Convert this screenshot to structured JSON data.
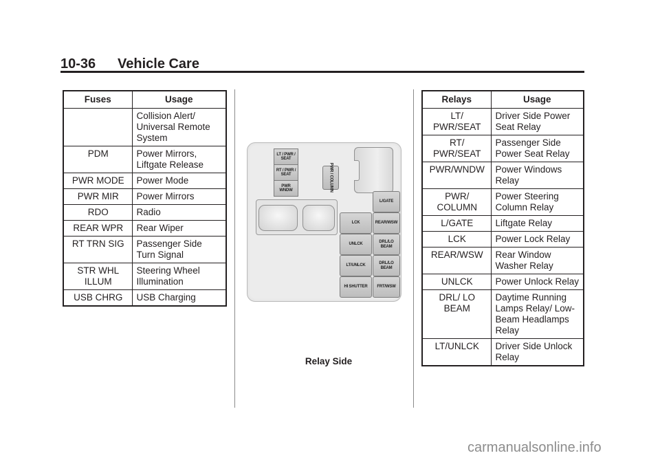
{
  "header": {
    "page_number": "10-36",
    "section_title": "Vehicle Care"
  },
  "fuses_table": {
    "headers": [
      "Fuses",
      "Usage"
    ],
    "rows": [
      {
        "code": "",
        "usage": "Collision Alert/ Universal Remote System"
      },
      {
        "code": "PDM",
        "usage": "Power Mirrors, Liftgate Release"
      },
      {
        "code": "PWR MODE",
        "usage": "Power Mode"
      },
      {
        "code": "PWR MIR",
        "usage": "Power Mirrors"
      },
      {
        "code": "RDO",
        "usage": "Radio"
      },
      {
        "code": "REAR WPR",
        "usage": "Rear Wiper"
      },
      {
        "code": "RT TRN SIG",
        "usage": "Passenger Side Turn Signal"
      },
      {
        "code": "STR WHL ILLUM",
        "usage": "Steering Wheel Illumination"
      },
      {
        "code": "USB CHRG",
        "usage": "USB Charging"
      }
    ]
  },
  "diagram": {
    "caption": "Relay Side",
    "relays": {
      "lt_pwr_seat": "LT / PWR / SEAT",
      "rt_pwr_seat": "RT / PWR / SEAT",
      "pwr_wndw": "PWR WNDW",
      "pwr_column": "PWR / COLUMN",
      "l_gate": "L/GATE",
      "lck": "LCK",
      "rear_wsw": "REAR/WSW",
      "unlck": "UNLCK",
      "drl_lo_beam_1": "DRL/LO BEAM",
      "lt_unlck": "LT/UNLCK",
      "drl_lo_beam_2": "DRL/LO BEAM",
      "hi_shutter": "HI SHUTTER",
      "frt_wsw": "FRT/WSW"
    }
  },
  "relays_table": {
    "headers": [
      "Relays",
      "Usage"
    ],
    "rows": [
      {
        "code": "LT/ PWR/SEAT",
        "usage": "Driver Side Power Seat Relay"
      },
      {
        "code": "RT/ PWR/SEAT",
        "usage": "Passenger Side Power Seat Relay"
      },
      {
        "code": "PWR/WNDW",
        "usage": "Power Windows Relay"
      },
      {
        "code": "PWR/ COLUMN",
        "usage": "Power Steering Column Relay"
      },
      {
        "code": "L/GATE",
        "usage": "Liftgate Relay"
      },
      {
        "code": "LCK",
        "usage": "Power Lock Relay"
      },
      {
        "code": "REAR/WSW",
        "usage": "Rear Window Washer Relay"
      },
      {
        "code": "UNLCK",
        "usage": "Power Unlock Relay"
      },
      {
        "code": "DRL/ LO BEAM",
        "usage": "Daytime Running Lamps Relay/ Low-Beam Headlamps Relay"
      },
      {
        "code": "LT/UNLCK",
        "usage": "Driver Side Unlock Relay"
      }
    ]
  },
  "watermark": "carmanualsonline.info"
}
